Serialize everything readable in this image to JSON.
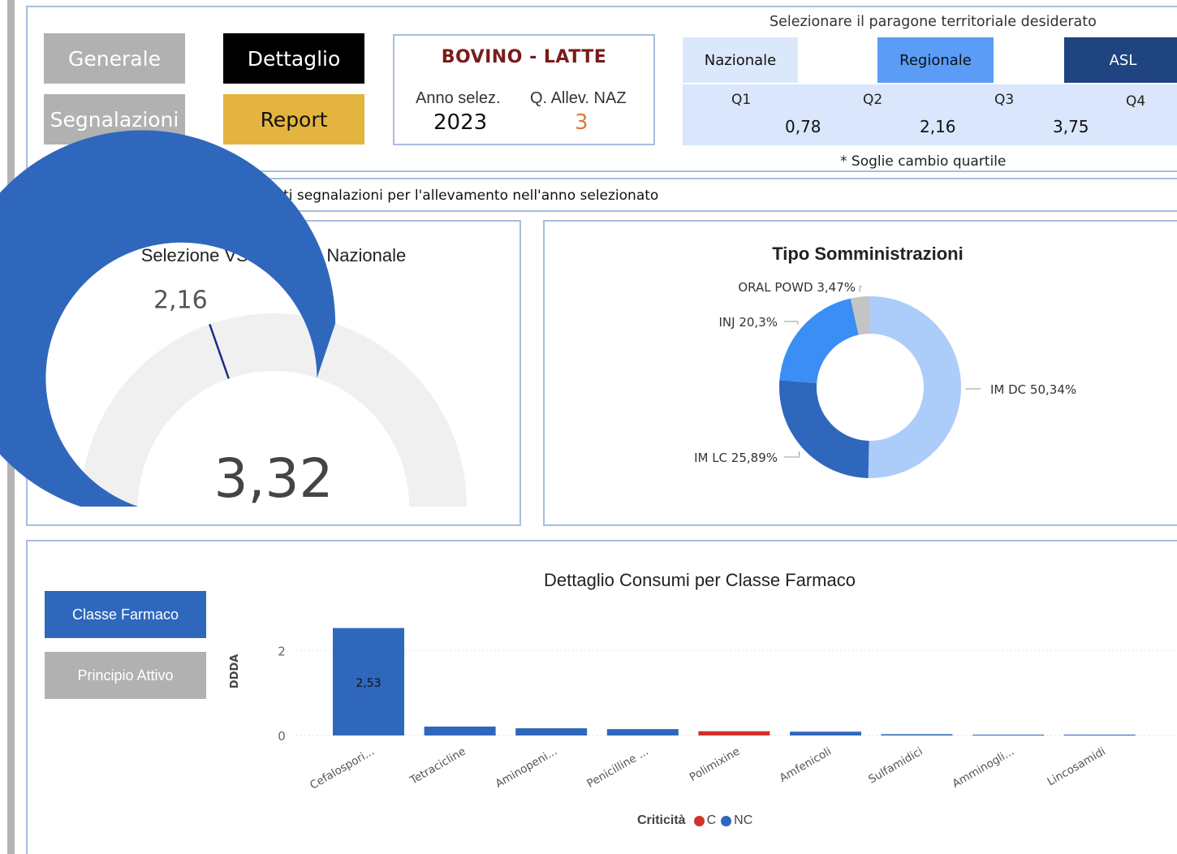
{
  "nav": {
    "generale": "Generale",
    "dettaglio": "Dettaglio",
    "segnalazioni": "Segnalazioni",
    "report": "Report"
  },
  "info": {
    "species": "BOVINO - LATTE",
    "anno_label": "Anno selez.",
    "anno_value": "2023",
    "qallev_label": "Q. Allev. NAZ",
    "qallev_value": "3"
  },
  "territorial": {
    "title": "Selezionare il paragone territoriale desiderato",
    "buttons": [
      "Nazionale",
      "Regionale",
      "ASL"
    ],
    "quartiles": [
      "Q1",
      "Q2",
      "Q3",
      "Q4"
    ],
    "thresholds": [
      "0,78",
      "2,16",
      "3,75"
    ],
    "note": "* Soglie cambio quartile"
  },
  "notice": {
    "text": "Non sono presenti segnalazioni per l'allevamento nell'anno selezionato"
  },
  "gauge": {
    "title": "Selezione VS Mediana Nazionale",
    "value": 3.32,
    "value_label": "3,32",
    "target": 2.16,
    "target_label": "2,16",
    "min": 0,
    "max": 5.5,
    "fill_color": "#2f67bd",
    "track_color": "#f0f0f0",
    "target_color": "#1a2a8a"
  },
  "donut": {
    "title": "Tipo Somministrazioni",
    "slices": [
      {
        "name": "IM DC",
        "value": 50.34,
        "label": "IM DC 50,34%",
        "color": "#acccf9"
      },
      {
        "name": "IM LC",
        "value": 25.89,
        "label": "IM LC 25,89%",
        "color": "#2f67bd"
      },
      {
        "name": "INJ",
        "value": 20.3,
        "label": "INJ 20,3%",
        "color": "#3a8ef5"
      },
      {
        "name": "ORAL POWD",
        "value": 3.47,
        "label": "ORAL POWD 3,47%",
        "color": "#c4c4c4"
      }
    ]
  },
  "toggles": {
    "classe": "Classe Farmaco",
    "principio": "Principio Attivo"
  },
  "chart_data": {
    "type": "bar",
    "title": "Dettaglio Consumi per Classe Farmaco",
    "ylabel": "DDDA",
    "xlabel": "",
    "ylim": [
      0,
      2.6
    ],
    "yticks": [
      "0",
      "2"
    ],
    "categories": [
      "Cefalospori...",
      "Tetracicline",
      "Aminopeni...",
      "Penicilline ...",
      "Polimixine",
      "Amfenicoli",
      "Sulfamidici",
      "Amminogli...",
      "Lincosamidi"
    ],
    "values": [
      2.53,
      0.21,
      0.17,
      0.15,
      0.1,
      0.09,
      0.03,
      0.02,
      0.02
    ],
    "criticita": [
      "NC",
      "NC",
      "NC",
      "NC",
      "C",
      "NC",
      "NC",
      "NC",
      "NC"
    ],
    "data_labels": [
      "2,53",
      "",
      "",
      "",
      "",
      "",
      "",
      "",
      ""
    ],
    "legend": {
      "title": "Criticità",
      "items": [
        {
          "name": "C",
          "color": "#d0312d"
        },
        {
          "name": "NC",
          "color": "#2f67bd"
        }
      ],
      "position": "bottom"
    }
  }
}
